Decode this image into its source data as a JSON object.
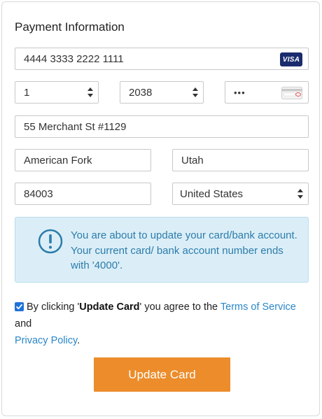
{
  "form": {
    "title": "Payment Information",
    "card_number": "4444 3333 2222 1111",
    "card_brand": "VISA",
    "exp_month": "1",
    "exp_year": "2038",
    "cvv_masked": "•••",
    "address": "55 Merchant St #1129",
    "city": "American Fork",
    "state": "Utah",
    "zip": "84003",
    "country": "United States"
  },
  "notice": {
    "text": "You are about to update your card/bank account. Your current card/ bank account number ends with '4000'.",
    "color": "#2c7cab",
    "background": "#dbeef7"
  },
  "agreement": {
    "checked": true,
    "prefix": "By clicking '",
    "button_ref": "Update Card",
    "middle": "' you agree to the ",
    "terms_link": "Terms of Service",
    "and": " and",
    "privacy_link": "Privacy Policy",
    "suffix": "."
  },
  "submit": {
    "label": "Update Card",
    "color": "#ec8c2b"
  }
}
